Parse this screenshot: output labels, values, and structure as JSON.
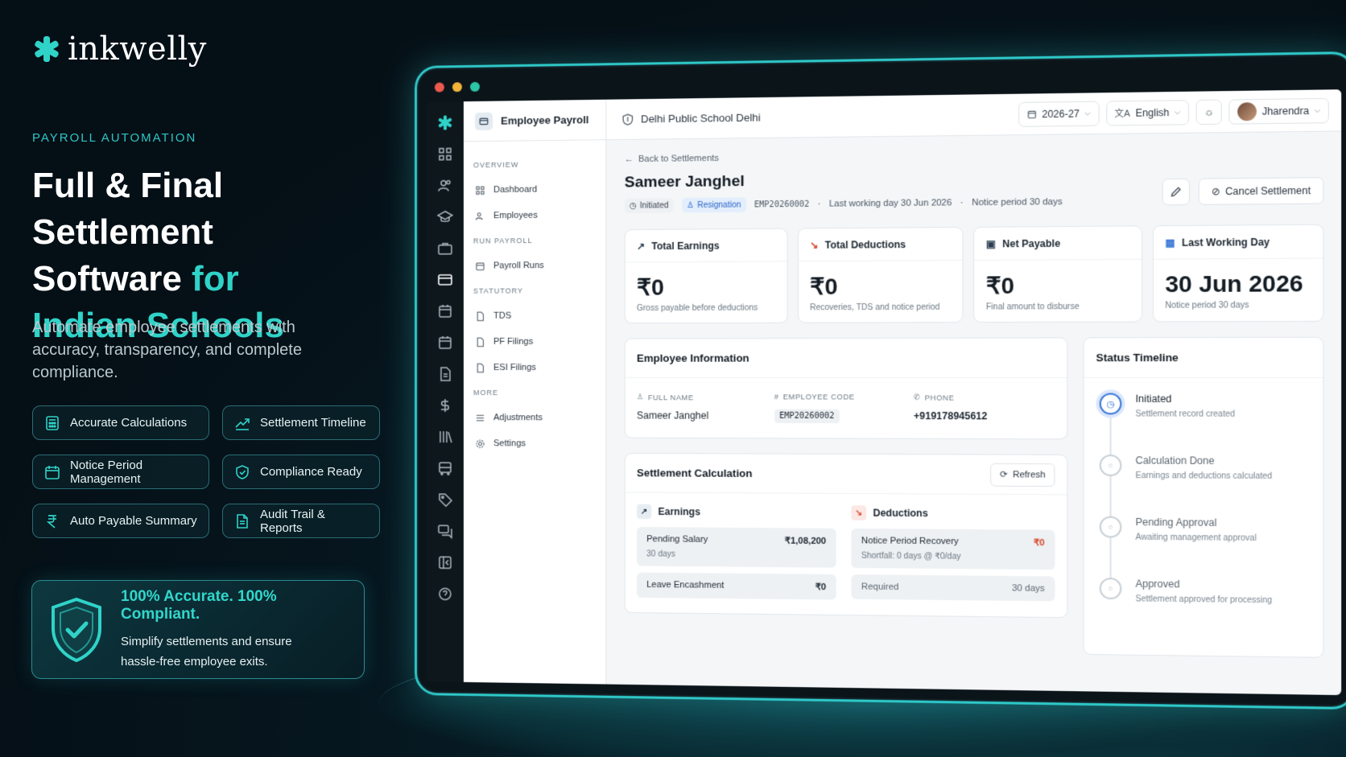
{
  "brand": {
    "name": "inkwelly"
  },
  "hero": {
    "eyebrow": "PAYROLL AUTOMATION",
    "title_line1": "Full & Final Settlement",
    "title_line2_plain": "Software ",
    "title_line2_accent": "for",
    "title_line3_accent": "Indian Schools",
    "subtitle": "Automate employee settlements with accuracy, transparency, and complete compliance."
  },
  "features": [
    {
      "label": "Accurate Calculations",
      "icon": "calculator-icon"
    },
    {
      "label": "Settlement Timeline",
      "icon": "trend-icon"
    },
    {
      "label": "Notice Period Management",
      "icon": "calendar-icon"
    },
    {
      "label": "Compliance Ready",
      "icon": "shield-check-icon"
    },
    {
      "label": "Auto Payable Summary",
      "icon": "rupee-icon"
    },
    {
      "label": "Audit Trail & Reports",
      "icon": "document-icon"
    }
  ],
  "badge": {
    "title": "100% Accurate. 100% Compliant.",
    "line1": "Simplify settlements and ensure",
    "line2": "hassle-free employee exits."
  },
  "colors": {
    "accent": "#2fd3c8",
    "frame": "#2ec8c8",
    "primary_blue": "#3b78d8"
  },
  "app": {
    "module_title": "Employee Payroll",
    "school": "Delhi Public School Delhi",
    "year": "2026-27",
    "language": "English",
    "user": "Jharendra"
  },
  "sidebar": {
    "sections": [
      {
        "title": "OVERVIEW",
        "items": [
          "Dashboard",
          "Employees"
        ]
      },
      {
        "title": "RUN PAYROLL",
        "items": [
          "Payroll Runs"
        ]
      },
      {
        "title": "STATUTORY",
        "items": [
          "TDS",
          "PF Filings",
          "ESI Filings"
        ]
      },
      {
        "title": "MORE",
        "items": [
          "Adjustments",
          "Settings"
        ]
      }
    ]
  },
  "employee": {
    "back_label": "Back to Settlements",
    "name": "Sameer Janghel",
    "status": "Initiated",
    "type": "Resignation",
    "code": "EMP20260002",
    "last_working": "Last working day 30 Jun 2026",
    "notice": "Notice period 30 days",
    "cancel_label": "Cancel Settlement"
  },
  "summary_cards": [
    {
      "title": "Total Earnings",
      "value": "₹0",
      "sub": "Gross payable before deductions"
    },
    {
      "title": "Total Deductions",
      "value": "₹0",
      "sub": "Recoveries, TDS and notice period"
    },
    {
      "title": "Net Payable",
      "value": "₹0",
      "sub": "Final amount to disburse"
    },
    {
      "title": "Last Working Day",
      "value": "30 Jun 2026",
      "sub": "Notice period 30 days"
    }
  ],
  "info": {
    "title": "Employee Information",
    "full_name_label": "FULL NAME",
    "full_name": "Sameer Janghel",
    "code_label": "EMPLOYEE CODE",
    "code": "EMP20260002",
    "phone_label": "PHONE",
    "phone": "+919178945612"
  },
  "calc": {
    "title": "Settlement Calculation",
    "refresh_label": "Refresh",
    "earnings_title": "Earnings",
    "deductions_title": "Deductions",
    "earnings": [
      {
        "label": "Pending Salary",
        "value": "₹1,08,200",
        "sub": "30 days"
      },
      {
        "label": "Leave Encashment",
        "value": "₹0",
        "sub": ""
      }
    ],
    "deductions": [
      {
        "label": "Notice Period Recovery",
        "value": "₹0",
        "sub": "Shortfall: 0 days @ ₹0/day"
      },
      {
        "label": "Required",
        "value": "30 days",
        "sub": ""
      }
    ]
  },
  "timeline": {
    "title": "Status Timeline",
    "steps": [
      {
        "title": "Initiated",
        "sub": "Settlement record created"
      },
      {
        "title": "Calculation Done",
        "sub": "Earnings and deductions calculated"
      },
      {
        "title": "Pending Approval",
        "sub": "Awaiting management approval"
      },
      {
        "title": "Approved",
        "sub": "Settlement approved for processing"
      }
    ]
  }
}
